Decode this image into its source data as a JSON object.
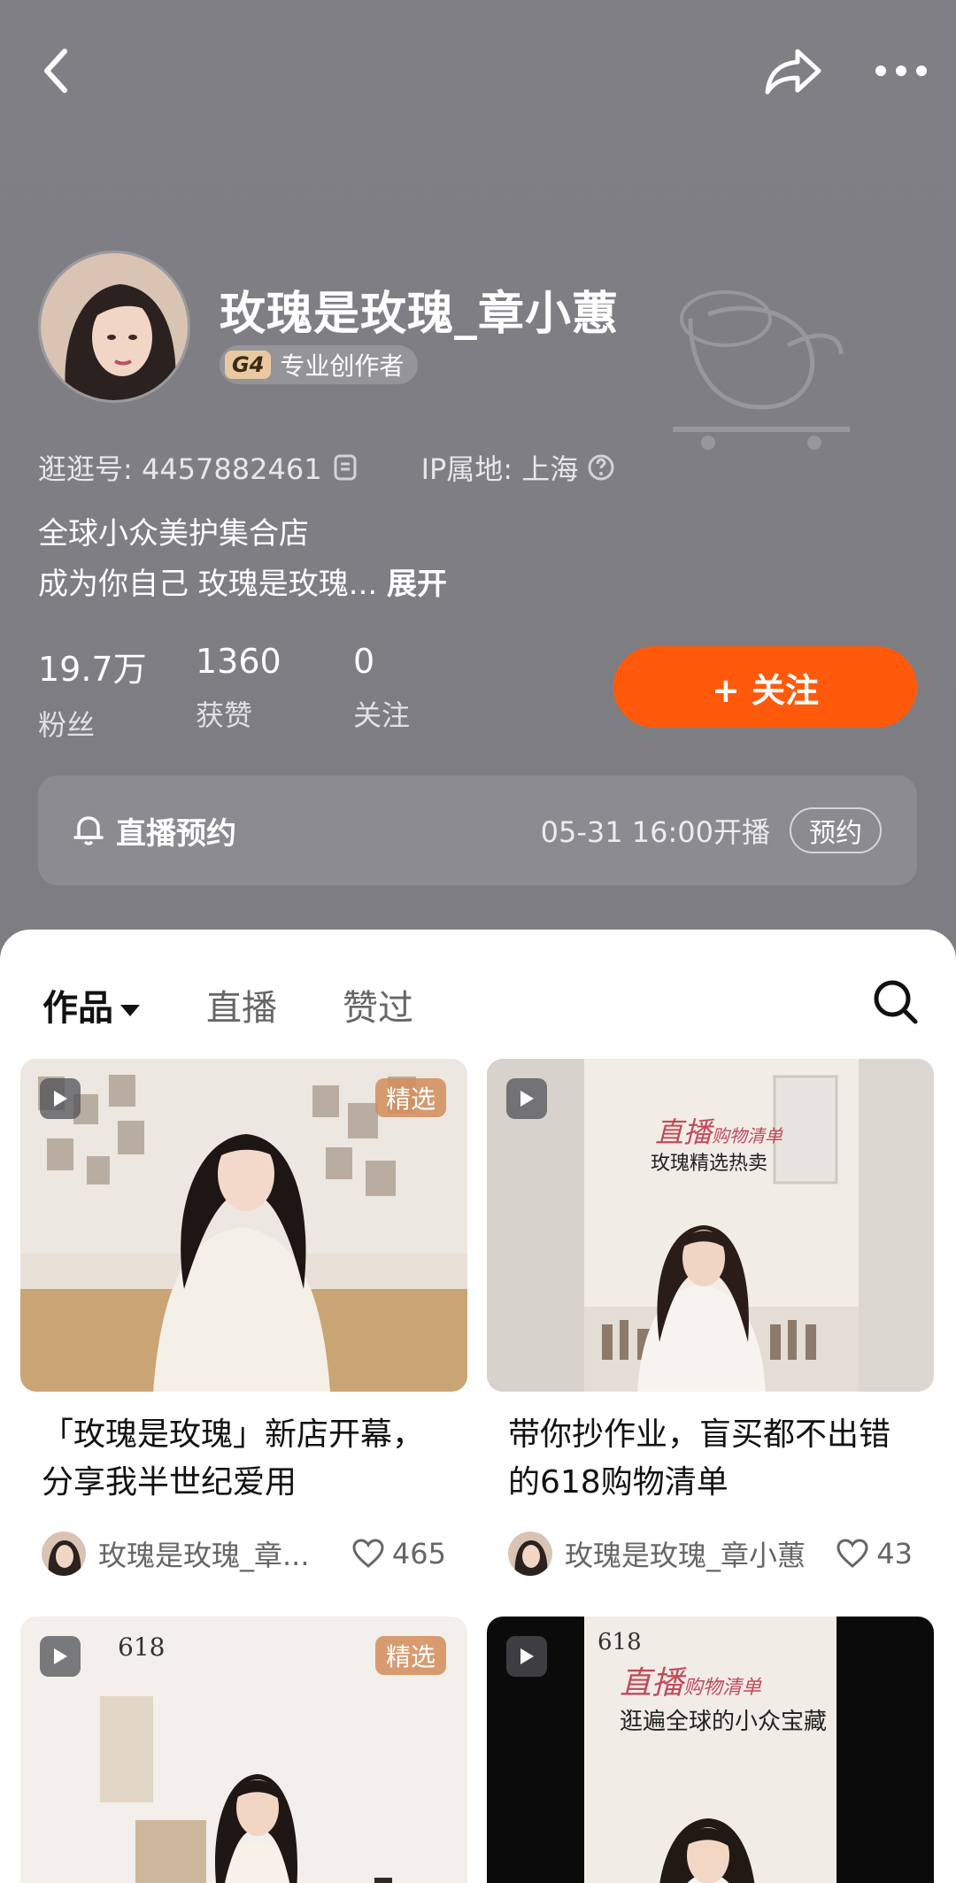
{
  "profile": {
    "name": "玫瑰是玫瑰_章小蕙",
    "badge_level": "G4",
    "badge_text": "专业创作者",
    "id_label": "逛逛号: 4457882461",
    "ip_label": "IP属地: 上海",
    "bio_line1": "全球小众美护集合店",
    "bio_line2": "成为你自己 玫瑰是玫瑰...",
    "expand_label": "展开"
  },
  "stats": [
    {
      "num": "19.7万",
      "label": "粉丝"
    },
    {
      "num": "1360",
      "label": "获赞"
    },
    {
      "num": "0",
      "label": "关注"
    }
  ],
  "follow_label": "+ 关注",
  "live": {
    "title": "直播预约",
    "time": "05-31 16:00开播",
    "reserve_label": "预约"
  },
  "tabs": [
    {
      "label": "作品"
    },
    {
      "label": "直播"
    },
    {
      "label": "赞过"
    }
  ],
  "posts": [
    {
      "title": "「玫瑰是玫瑰」新店开幕，分享我半世纪爱用",
      "tag": "精选",
      "author": "玫瑰是玫瑰_章...",
      "likes": "465"
    },
    {
      "title": "带你抄作业，盲买都不出错的618购物清单",
      "tag": "",
      "author": "玫瑰是玫瑰_章小蕙",
      "likes": "43"
    },
    {
      "title": "",
      "tag": "精选",
      "author": "",
      "likes": ""
    },
    {
      "title": "",
      "tag": "",
      "author": "",
      "likes": ""
    }
  ],
  "thumb_texts": {
    "p2_line1": "直播",
    "p2_line1b": "购物清单",
    "p2_line2": "玫瑰精选热卖",
    "p3_top": "618",
    "p4_top": "618",
    "p4_line1": "直播",
    "p4_line1b": "购物清单",
    "p4_line2": "逛遍全球的小众宝藏"
  },
  "colors": {
    "accent": "#ff5a0c",
    "header_bg": "#7e7e83"
  }
}
